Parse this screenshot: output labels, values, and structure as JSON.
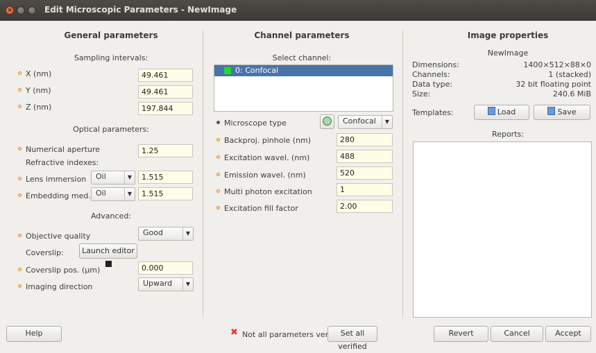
{
  "window": {
    "title": "Edit Microscopic Parameters - NewImage"
  },
  "general": {
    "header": "General parameters",
    "sampling_header": "Sampling intervals:",
    "x_label": "X (nm)",
    "x_value": "49.461",
    "y_label": "Y (nm)",
    "y_value": "49.461",
    "z_label": "Z (nm)",
    "z_value": "197.844",
    "optical_header": "Optical parameters:",
    "na_label": "Numerical aperture",
    "na_value": "1.25",
    "refr_label": "Refractive indexes:",
    "lens_label": "Lens immersion",
    "lens_medium": "Oil",
    "lens_value": "1.515",
    "embed_label": "Embedding med.",
    "embed_medium": "Oil",
    "embed_value": "1.515",
    "advanced_header": "Advanced:",
    "objq_label": "Objective quality",
    "objq_value": "Good",
    "coverslip_label": "Coverslip:",
    "launch_editor": "Launch editor",
    "coverpos_label": "Coverslip pos. (µm)",
    "coverpos_value": "0.000",
    "imgdir_label": "Imaging direction",
    "imgdir_value": "Upward"
  },
  "channel": {
    "header": "Channel parameters",
    "select_label": "Select channel:",
    "channels": [
      "0: Confocal"
    ],
    "mtype_label": "Microscope type",
    "mtype_value": "Confocal",
    "pinhole_label": "Backproj. pinhole (nm)",
    "pinhole_value": "280",
    "exc_label": "Excitation wavel. (nm)",
    "exc_value": "488",
    "em_label": "Emission wavel. (nm)",
    "em_value": "520",
    "mpe_label": "Multi photon excitation",
    "mpe_value": "1",
    "eff_label": "Excitation fill factor",
    "eff_value": "2.00"
  },
  "image": {
    "header": "Image properties",
    "name": "NewImage",
    "dim_label": "Dimensions:",
    "dim_value": "1400×512×88×0",
    "ch_label": "Channels:",
    "ch_value": "1 (stacked)",
    "dt_label": "Data type:",
    "dt_value": "32 bit floating point",
    "size_label": "Size:",
    "size_value": "240.6 MiB",
    "templates_label": "Templates:",
    "load": "Load",
    "save": "Save",
    "reports_label": "Reports:"
  },
  "footer": {
    "help": "Help",
    "status": "Not all parameters verified",
    "set_all": "Set all verified",
    "revert": "Revert",
    "cancel": "Cancel",
    "accept": "Accept"
  },
  "colors": {
    "titlebar": "#3b3a36",
    "field_bg": "#fdfde8",
    "selection": "#4a74a8",
    "dot": "#e08a26",
    "status_x": "#e33"
  }
}
